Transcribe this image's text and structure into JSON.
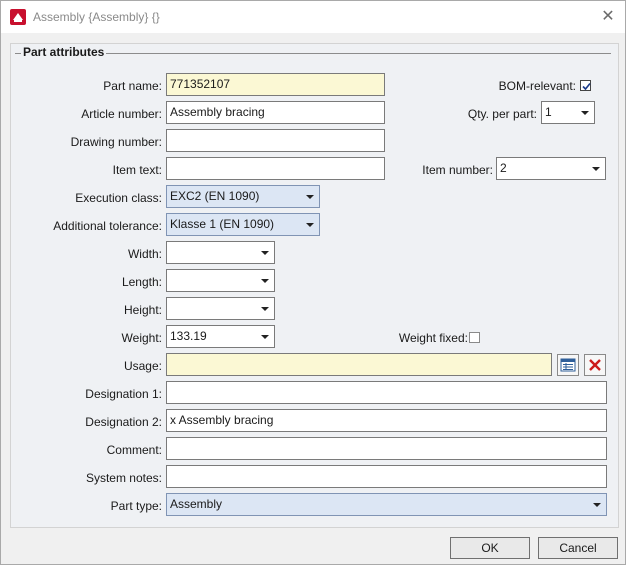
{
  "window": {
    "title": "Assembly  {Assembly} {}"
  },
  "group": {
    "title": "Part attributes"
  },
  "labels": {
    "part_name": "Part name:",
    "article_number": "Article number:",
    "drawing_number": "Drawing number:",
    "item_text": "Item text:",
    "execution_class": "Execution class:",
    "additional_tolerance": "Additional tolerance:",
    "width": "Width:",
    "length": "Length:",
    "height": "Height:",
    "weight": "Weight:",
    "usage": "Usage:",
    "designation_1": "Designation 1:",
    "designation_2": "Designation 2:",
    "comment": "Comment:",
    "system_notes": "System notes:",
    "part_type": "Part type:",
    "bom_relevant": "BOM-relevant:",
    "qty_per_part": "Qty. per part:",
    "item_number": "Item number:",
    "weight_fixed": "Weight fixed:"
  },
  "values": {
    "part_name": "771352107",
    "article_number": "Assembly bracing",
    "drawing_number": "",
    "item_text": "",
    "execution_class": "EXC2 (EN 1090)",
    "additional_tolerance": "Klasse 1 (EN 1090)",
    "width": "",
    "length": "",
    "height": "",
    "weight": "133.19",
    "usage": "",
    "designation_1": "",
    "designation_2": "x Assembly bracing",
    "comment": "",
    "system_notes": "",
    "part_type": "Assembly",
    "qty_per_part": "1",
    "item_number": "2",
    "bom_relevant_checked": true,
    "weight_fixed_checked": false
  },
  "buttons": {
    "ok": "OK",
    "cancel": "Cancel"
  },
  "icons": {
    "app": "app-logo-icon",
    "close": "close-icon",
    "usage_table": "table-list-icon",
    "usage_clear": "delete-x-icon"
  },
  "colors": {
    "highlight_field": "#fbf8d4",
    "combo_blue": "#dce6f4",
    "clear_icon_red": "#cc1a1a"
  }
}
